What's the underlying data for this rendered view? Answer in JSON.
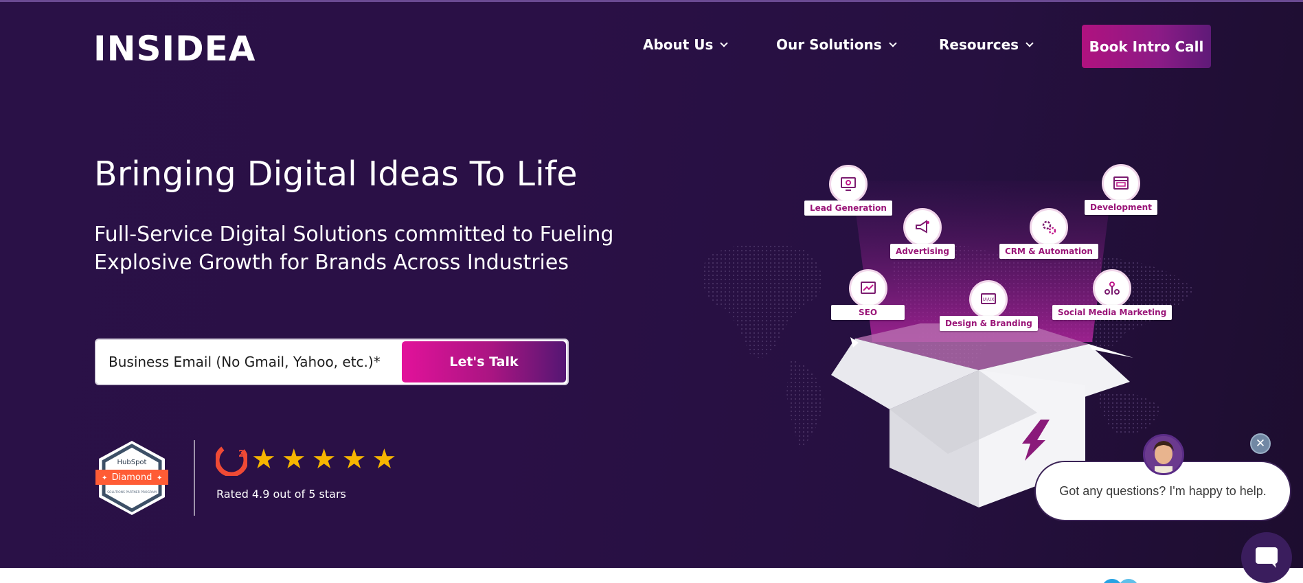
{
  "header": {
    "logo": "INSIDEA",
    "nav": [
      {
        "label": "About Us"
      },
      {
        "label": "Our Solutions"
      },
      {
        "label": "Resources"
      }
    ],
    "cta_label": "Book Intro Call"
  },
  "hero": {
    "headline": "Bringing Digital Ideas To Life",
    "subhead_line1": "Full-Service Digital Solutions committed to Fueling",
    "subhead_line2": "Explosive Growth for Brands Across Industries",
    "email_placeholder": "Business Email (No Gmail, Yahoo, etc.)*",
    "submit_label": "Let's Talk"
  },
  "badges": {
    "hubspot_brand": "HubSpot",
    "hubspot_tier": "Diamond",
    "hubspot_caption": "SOLUTIONS PARTNER PROGRAM",
    "g2_stars": 5,
    "rating_text": "Rated 4.9 out of 5 stars"
  },
  "services": [
    {
      "label": "Lead Generation",
      "icon": "monitor-gear-icon"
    },
    {
      "label": "Development",
      "icon": "browser-code-icon"
    },
    {
      "label": "Advertising",
      "icon": "megaphone-icon"
    },
    {
      "label": "CRM & Automation",
      "icon": "gears-icon"
    },
    {
      "label": "SEO",
      "icon": "seo-chart-icon"
    },
    {
      "label": "Design & Branding",
      "icon": "ui-ux-icon"
    },
    {
      "label": "Social Media Marketing",
      "icon": "social-network-icon"
    }
  ],
  "chat": {
    "message": "Got any questions? I'm happy to help.",
    "close_symbol": "✕"
  },
  "colors": {
    "hero_bg": "#2a1147",
    "accent_pink": "#e2129a",
    "accent_purple": "#541673",
    "star": "#f6b500",
    "service_label": "#9a1578"
  }
}
